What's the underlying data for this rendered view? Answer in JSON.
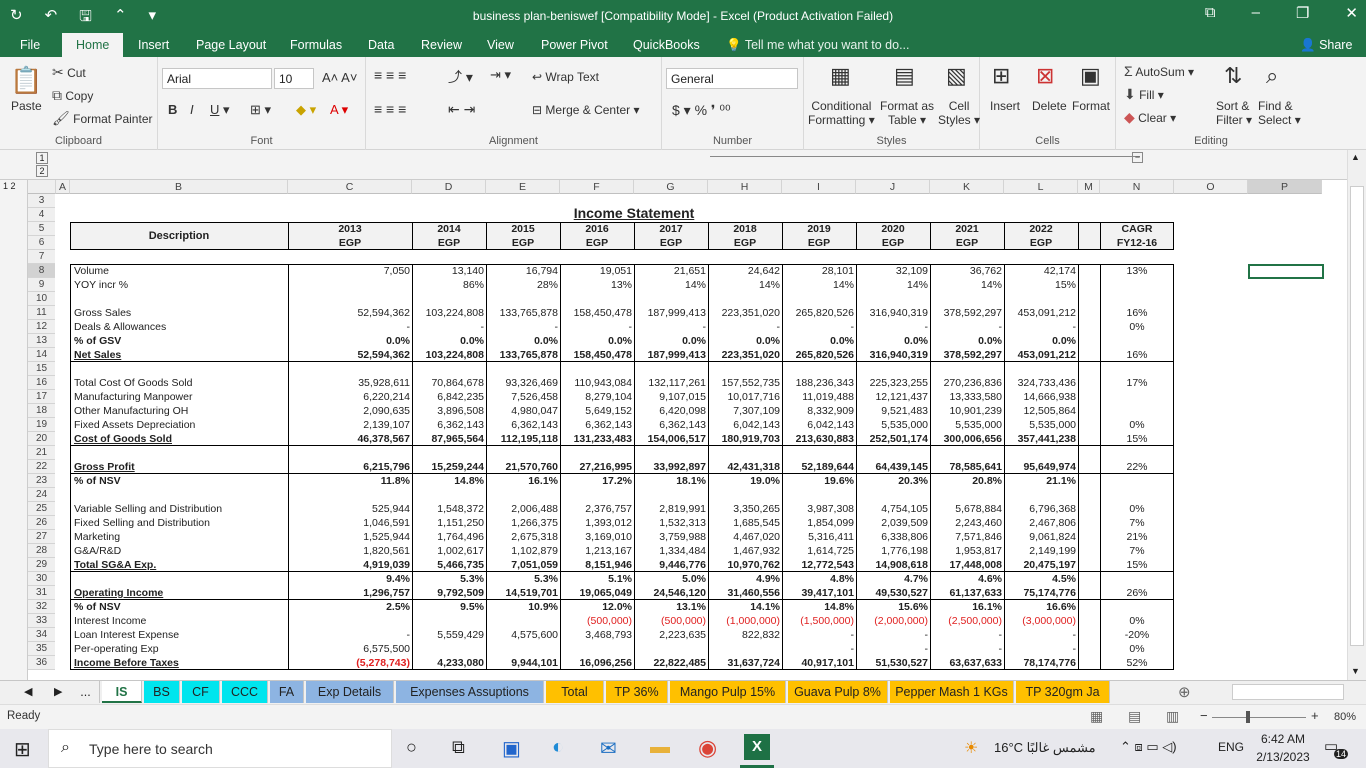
{
  "window": {
    "title": "business plan-beniswef  [Compatibility Mode] - Excel (Product Activation Failed)",
    "share": "Share"
  },
  "menu": [
    "File",
    "Home",
    "Insert",
    "Page Layout",
    "Formulas",
    "Data",
    "Review",
    "View",
    "Power Pivot",
    "QuickBooks"
  ],
  "tellme": "Tell me what you want to do...",
  "ribbon": {
    "clipboard": {
      "paste": "Paste",
      "cut": "Cut",
      "copy": "Copy",
      "painter": "Format Painter",
      "label": "Clipboard"
    },
    "font": {
      "name": "Arial",
      "size": "10",
      "label": "Font"
    },
    "alignment": {
      "wrap": "Wrap Text",
      "merge": "Merge & Center",
      "label": "Alignment"
    },
    "number": {
      "format": "General",
      "label": "Number"
    },
    "styles": {
      "cond": "Conditional",
      "cond2": "Formatting",
      "fmtTable": "Format as",
      "fmtTable2": "Table",
      "cell": "Cell",
      "cell2": "Styles",
      "label": "Styles"
    },
    "cells": {
      "insert": "Insert",
      "delete": "Delete",
      "format": "Format",
      "label": "Cells"
    },
    "editing": {
      "autosum": "AutoSum",
      "fill": "Fill",
      "clear": "Clear",
      "sort": "Sort &",
      "sort2": "Filter",
      "find": "Find &",
      "find2": "Select",
      "label": "Editing"
    }
  },
  "columns": [
    "A",
    "B",
    "C",
    "D",
    "E",
    "F",
    "G",
    "H",
    "I",
    "J",
    "K",
    "L",
    "M",
    "N",
    "O",
    "P"
  ],
  "sheet": {
    "title": "Income Statement",
    "desc": "Description",
    "years": [
      "2013",
      "2014",
      "2015",
      "2016",
      "2017",
      "2018",
      "2019",
      "2020",
      "2021",
      "2022"
    ],
    "cur": "EGP",
    "cagr": "CAGR",
    "cagr2": "FY12-16",
    "rows": [
      {
        "n": "8",
        "label": "Volume",
        "v": [
          "7,050",
          "13,140",
          "16,794",
          "19,051",
          "21,651",
          "24,642",
          "28,101",
          "32,109",
          "36,762",
          "42,174"
        ],
        "g": "13%"
      },
      {
        "n": "9",
        "label": "YOY incr %",
        "v": [
          "",
          "86%",
          "28%",
          "13%",
          "14%",
          "14%",
          "14%",
          "14%",
          "14%",
          "15%"
        ],
        "g": ""
      },
      {
        "n": "10",
        "label": "",
        "v": [],
        "g": ""
      },
      {
        "n": "11",
        "label": "Gross Sales",
        "v": [
          "52,594,362",
          "103,224,808",
          "133,765,878",
          "158,450,478",
          "187,999,413",
          "223,351,020",
          "265,820,526",
          "316,940,319",
          "378,592,297",
          "453,091,212"
        ],
        "g": "16%"
      },
      {
        "n": "12",
        "label": "Deals & Allowances",
        "v": [
          "-",
          "-",
          "-",
          "-",
          "-",
          "-",
          "-",
          "-",
          "-",
          "-"
        ],
        "g": "0%"
      },
      {
        "n": "13",
        "label": "% of GSV",
        "b": true,
        "v": [
          "0.0%",
          "0.0%",
          "0.0%",
          "0.0%",
          "0.0%",
          "0.0%",
          "0.0%",
          "0.0%",
          "0.0%",
          "0.0%"
        ],
        "g": ""
      },
      {
        "n": "14",
        "label": "Net Sales",
        "b": true,
        "u": true,
        "v": [
          "52,594,362",
          "103,224,808",
          "133,765,878",
          "158,450,478",
          "187,999,413",
          "223,351,020",
          "265,820,526",
          "316,940,319",
          "378,592,297",
          "453,091,212"
        ],
        "g": "16%"
      },
      {
        "n": "15",
        "label": "",
        "v": [],
        "g": ""
      },
      {
        "n": "16",
        "label": "Total Cost Of Goods Sold",
        "v": [
          "35,928,611",
          "70,864,678",
          "93,326,469",
          "110,943,084",
          "132,117,261",
          "157,552,735",
          "188,236,343",
          "225,323,255",
          "270,236,836",
          "324,733,436"
        ],
        "g": "17%"
      },
      {
        "n": "17",
        "label": "Manufacturing Manpower",
        "v": [
          "6,220,214",
          "6,842,235",
          "7,526,458",
          "8,279,104",
          "9,107,015",
          "10,017,716",
          "11,019,488",
          "12,121,437",
          "13,333,580",
          "14,666,938"
        ],
        "g": ""
      },
      {
        "n": "18",
        "label": "Other Manufacturing OH",
        "v": [
          "2,090,635",
          "3,896,508",
          "4,980,047",
          "5,649,152",
          "6,420,098",
          "7,307,109",
          "8,332,909",
          "9,521,483",
          "10,901,239",
          "12,505,864"
        ],
        "g": ""
      },
      {
        "n": "19",
        "label": "Fixed Assets Depreciation",
        "v": [
          "2,139,107",
          "6,362,143",
          "6,362,143",
          "6,362,143",
          "6,362,143",
          "6,042,143",
          "6,042,143",
          "5,535,000",
          "5,535,000",
          "5,535,000"
        ],
        "g": "0%"
      },
      {
        "n": "20",
        "label": "Cost of Goods Sold",
        "b": true,
        "u": true,
        "v": [
          "46,378,567",
          "87,965,564",
          "112,195,118",
          "131,233,483",
          "154,006,517",
          "180,919,703",
          "213,630,883",
          "252,501,174",
          "300,006,656",
          "357,441,238"
        ],
        "g": "15%"
      },
      {
        "n": "21",
        "label": "",
        "v": [],
        "g": ""
      },
      {
        "n": "22",
        "label": "Gross Profit",
        "b": true,
        "u": true,
        "v": [
          "6,215,796",
          "15,259,244",
          "21,570,760",
          "27,216,995",
          "33,992,897",
          "42,431,318",
          "52,189,644",
          "64,439,145",
          "78,585,641",
          "95,649,974"
        ],
        "g": "22%"
      },
      {
        "n": "23",
        "label": "% of NSV",
        "b": true,
        "v": [
          "11.8%",
          "14.8%",
          "16.1%",
          "17.2%",
          "18.1%",
          "19.0%",
          "19.6%",
          "20.3%",
          "20.8%",
          "21.1%"
        ],
        "g": ""
      },
      {
        "n": "24",
        "label": "",
        "v": [],
        "g": ""
      },
      {
        "n": "25",
        "label": "Variable Selling and Distribution",
        "v": [
          "525,944",
          "1,548,372",
          "2,006,488",
          "2,376,757",
          "2,819,991",
          "3,350,265",
          "3,987,308",
          "4,754,105",
          "5,678,884",
          "6,796,368"
        ],
        "g": "0%"
      },
      {
        "n": "26",
        "label": "Fixed Selling and Distribution",
        "v": [
          "1,046,591",
          "1,151,250",
          "1,266,375",
          "1,393,012",
          "1,532,313",
          "1,685,545",
          "1,854,099",
          "2,039,509",
          "2,243,460",
          "2,467,806"
        ],
        "g": "7%"
      },
      {
        "n": "27",
        "label": "Marketing",
        "v": [
          "1,525,944",
          "1,764,496",
          "2,675,318",
          "3,169,010",
          "3,759,988",
          "4,467,020",
          "5,316,411",
          "6,338,806",
          "7,571,846",
          "9,061,824"
        ],
        "g": "21%"
      },
      {
        "n": "28",
        "label": "G&A/R&D",
        "v": [
          "1,820,561",
          "1,002,617",
          "1,102,879",
          "1,213,167",
          "1,334,484",
          "1,467,932",
          "1,614,725",
          "1,776,198",
          "1,953,817",
          "2,149,199"
        ],
        "g": "7%"
      },
      {
        "n": "29",
        "label": "Total SG&A Exp.",
        "b": true,
        "u": true,
        "v": [
          "4,919,039",
          "5,466,735",
          "7,051,059",
          "8,151,946",
          "9,446,776",
          "10,970,762",
          "12,772,543",
          "14,908,618",
          "17,448,008",
          "20,475,197"
        ],
        "g": "15%"
      },
      {
        "n": "30",
        "label": "",
        "b": true,
        "v": [
          "9.4%",
          "5.3%",
          "5.3%",
          "5.1%",
          "5.0%",
          "4.9%",
          "4.8%",
          "4.7%",
          "4.6%",
          "4.5%"
        ],
        "g": ""
      },
      {
        "n": "31",
        "label": "Operating Income",
        "b": true,
        "u": true,
        "v": [
          "1,296,757",
          "9,792,509",
          "14,519,701",
          "19,065,049",
          "24,546,120",
          "31,460,556",
          "39,417,101",
          "49,530,527",
          "61,137,633",
          "75,174,776"
        ],
        "g": "26%"
      },
      {
        "n": "32",
        "label": "% of NSV",
        "b": true,
        "v": [
          "2.5%",
          "9.5%",
          "10.9%",
          "12.0%",
          "13.1%",
          "14.1%",
          "14.8%",
          "15.6%",
          "16.1%",
          "16.6%"
        ],
        "g": ""
      },
      {
        "n": "33",
        "label": "Interest Income",
        "red": true,
        "v": [
          "",
          "",
          "",
          "(500,000)",
          "(500,000)",
          "(1,000,000)",
          "(1,500,000)",
          "(2,000,000)",
          "(2,500,000)",
          "(3,000,000)"
        ],
        "g": "0%"
      },
      {
        "n": "34",
        "label": "Loan Interest Expense",
        "v": [
          "-",
          "5,559,429",
          "4,575,600",
          "3,468,793",
          "2,223,635",
          "822,832",
          "-",
          "-",
          "-",
          "-"
        ],
        "g": "-20%"
      },
      {
        "n": "35",
        "label": "Per-operating Exp",
        "v": [
          "6,575,500",
          "",
          "",
          "",
          "",
          "",
          "-",
          "-",
          "-",
          "-"
        ],
        "g": "0%"
      },
      {
        "n": "36",
        "label": "Income Before Taxes",
        "b": true,
        "u": true,
        "firstRed": true,
        "v": [
          "(5,278,743)",
          "4,233,080",
          "9,944,101",
          "16,096,256",
          "22,822,485",
          "31,637,724",
          "40,917,101",
          "51,530,527",
          "63,637,633",
          "78,174,776"
        ],
        "g": "52%"
      }
    ]
  },
  "tabs": [
    {
      "label": "...",
      "bg": "#f0f0f0"
    },
    {
      "label": "IS",
      "bg": "#ffffff",
      "active": true
    },
    {
      "label": "BS",
      "bg": "#00e5ee"
    },
    {
      "label": "CF",
      "bg": "#00e5ee"
    },
    {
      "label": "CCC",
      "bg": "#00e5ee"
    },
    {
      "label": "FA",
      "bg": "#8db4e2"
    },
    {
      "label": "Exp Details",
      "bg": "#8db4e2"
    },
    {
      "label": "Expenses Assuptions",
      "bg": "#8db4e2"
    },
    {
      "label": "Total",
      "bg": "#ffc000"
    },
    {
      "label": "TP 36%",
      "bg": "#ffc000"
    },
    {
      "label": "Mango Pulp 15%",
      "bg": "#ffc000"
    },
    {
      "label": "Guava Pulp 8%",
      "bg": "#ffc000"
    },
    {
      "label": "Pepper Mash 1 KGs",
      "bg": "#ffc000"
    },
    {
      "label": "TP 320gm Ja",
      "bg": "#ffc000"
    }
  ],
  "status": {
    "ready": "Ready",
    "zoom": "80%"
  },
  "taskbar": {
    "search": "Type here to search",
    "weather": "16°C  مشمس غالبًا",
    "lang": "ENG",
    "time": "6:42 AM",
    "date": "2/13/2023",
    "notif": "14"
  }
}
